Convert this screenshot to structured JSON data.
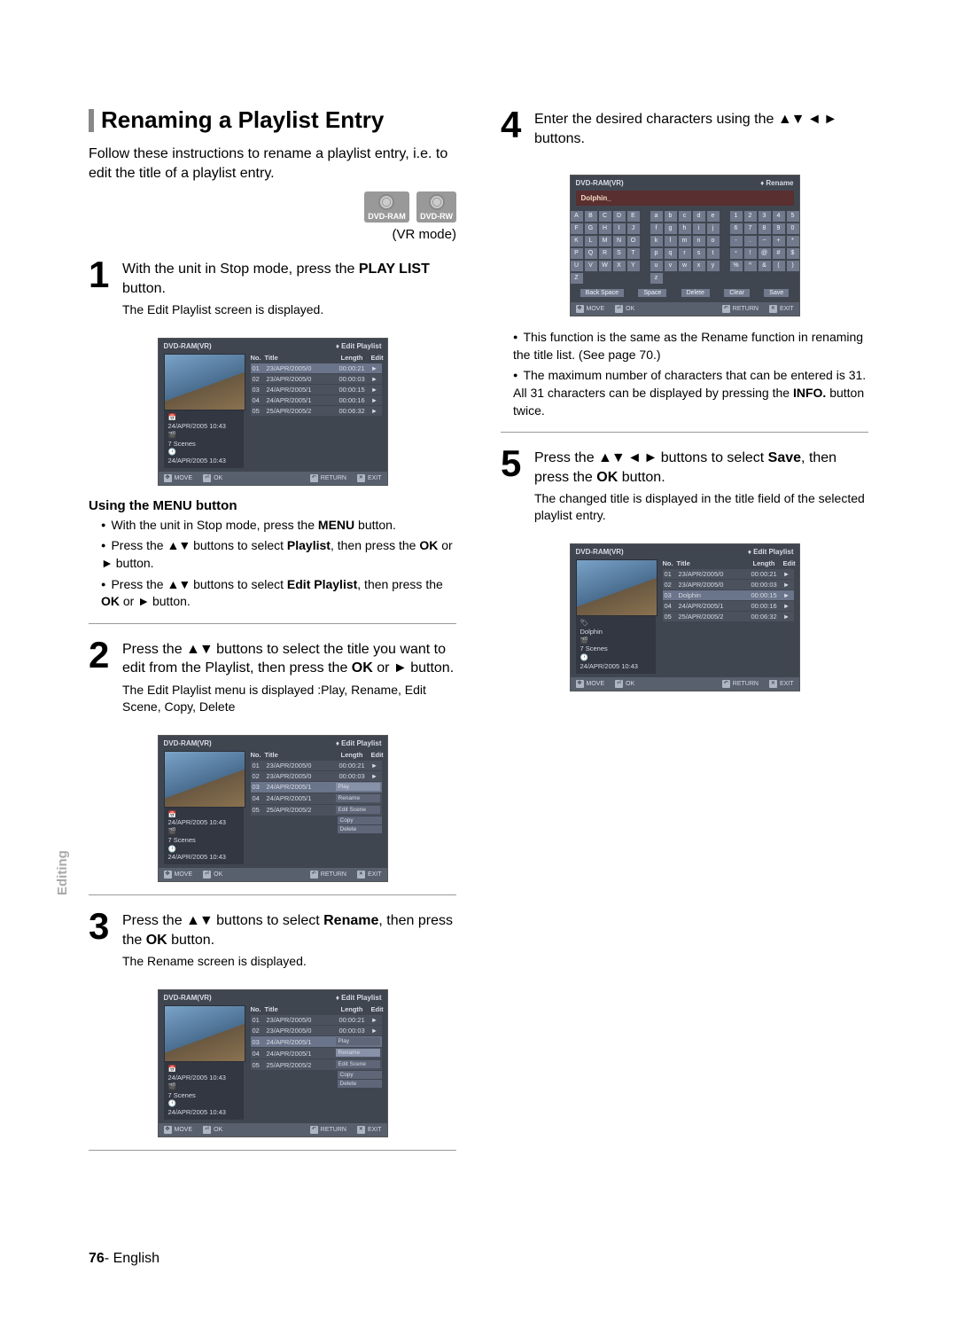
{
  "heading": "Renaming a Playlist Entry",
  "intro": "Follow these instructions to rename a playlist entry, i.e. to edit the title of a playlist entry.",
  "disc_labels": [
    "DVD-RAM",
    "DVD-RW"
  ],
  "vr_mode": "(VR mode)",
  "steps": {
    "s1": {
      "num": "1",
      "text_1": "With the unit in Stop mode, press the ",
      "bold": "PLAY LIST",
      "text_2": " button.",
      "sub": "The Edit Playlist screen is displayed."
    },
    "s2": {
      "num": "2",
      "text_1": "Press the ",
      "arrows1": "▲▼",
      "text_2": " buttons to select the title you want to edit from the Playlist, then press the ",
      "bold1": "OK",
      "or": " or ",
      "arrow2": "►",
      "text_3": " button.",
      "sub": "The Edit Playlist menu is displayed :Play, Rename, Edit Scene, Copy, Delete"
    },
    "s3": {
      "num": "3",
      "text_1": "Press the ",
      "arrows1": "▲▼",
      "text_2": " buttons to select ",
      "bold": "Rename",
      "text_3": ", then press the ",
      "bold2": "OK",
      "text_4": " button.",
      "sub": "The Rename screen is displayed."
    },
    "s4": {
      "num": "4",
      "text_1": "Enter the desired characters using the ",
      "arrows1": "▲▼ ◄ ►",
      "text_2": " buttons."
    },
    "s5": {
      "num": "5",
      "text_1": "Press the ",
      "arrows1": "▲▼ ◄ ►",
      "text_2": " buttons to select ",
      "bold": "Save",
      "text_3": ", then press the ",
      "bold2": "OK",
      "text_4": " button.",
      "sub": "The changed title is displayed in the title field of the selected playlist entry."
    }
  },
  "using_menu": {
    "title": "Using the MENU button",
    "items": [
      "With the unit in Stop mode, press the <b>MENU</b> button.",
      "Press the <span class=\"arrows\">▲▼</span> buttons to select <b>Playlist</b>, then press the <b>OK</b> or <span class=\"arrows\">►</span> button.",
      "Press the <span class=\"arrows\">▲▼</span> buttons to select <b>Edit Playlist</b>, then press the <b>OK</b> or <span class=\"arrows\">►</span> button."
    ]
  },
  "step4_bullets": [
    "This function is the same as the Rename function in renaming the title list. (See page 70.)",
    "The maximum number of characters that can be entered is 31. All 31 characters can be displayed by pressing the <b>INFO.</b> button twice."
  ],
  "screen_common": {
    "header_left": "DVD-RAM(VR)",
    "header_edit": "Edit Playlist",
    "header_rename": "Rename",
    "list_cols": {
      "no": "No.",
      "title": "Title",
      "length": "Length",
      "edit": "Edit"
    },
    "meta": {
      "date": "24/APR/2005 10:43",
      "scenes": "7 Scenes",
      "date2": "24/APR/2005 10:43"
    },
    "meta_dolphin": "Dolphin",
    "bottom": {
      "move": "MOVE",
      "ok": "OK",
      "return": "RETURN",
      "exit": "EXIT"
    }
  },
  "screen_rows": [
    {
      "no": "01",
      "title": "23/APR/2005/0",
      "len": "00:00:21"
    },
    {
      "no": "02",
      "title": "23/APR/2005/0",
      "len": "00:00:03"
    },
    {
      "no": "03",
      "title": "24/APR/2005/1",
      "len": "00:00:15"
    },
    {
      "no": "04",
      "title": "24/APR/2005/1",
      "len": "00:00:16"
    },
    {
      "no": "05",
      "title": "25/APR/2005/2",
      "len": "00:06:32"
    }
  ],
  "screen_rows_alt": [
    {
      "no": "01",
      "title": "23/APR/2005/0",
      "len": "00:00:21"
    },
    {
      "no": "02",
      "title": "23/APR/2005/0",
      "len": "00:00:03"
    },
    {
      "no": "03",
      "title": "Dolphin",
      "len": "00:00:15"
    },
    {
      "no": "04",
      "title": "24/APR/2005/1",
      "len": "00:00:16"
    },
    {
      "no": "05",
      "title": "25/APR/2005/2",
      "len": "00:06:32"
    }
  ],
  "context_menu": [
    "Play",
    "Rename",
    "Edit Scene",
    "Copy",
    "Delete"
  ],
  "rename_field": "Dolphin_",
  "keyboard": {
    "upper": [
      "A",
      "B",
      "C",
      "D",
      "E",
      "F",
      "G",
      "H",
      "I",
      "J",
      "K",
      "L",
      "M",
      "N",
      "O",
      "P",
      "Q",
      "R",
      "S",
      "T",
      "U",
      "V",
      "W",
      "X",
      "Y",
      "Z"
    ],
    "lower": [
      "a",
      "b",
      "c",
      "d",
      "e",
      "f",
      "g",
      "h",
      "i",
      "j",
      "k",
      "l",
      "m",
      "n",
      "o",
      "p",
      "q",
      "r",
      "s",
      "t",
      "u",
      "v",
      "w",
      "x",
      "y",
      "z"
    ],
    "sym": [
      "1",
      "2",
      "3",
      "4",
      "5",
      "6",
      "7",
      "8",
      "9",
      "0",
      "-",
      ".",
      "~",
      "+",
      "*",
      "﹡",
      "!",
      "@",
      "#",
      "$",
      "%",
      "^",
      "&",
      "(",
      ")"
    ]
  },
  "kb_actions": [
    "Back Space",
    "Space",
    "Delete",
    "Clear",
    "Save"
  ],
  "sidetab": "Editing",
  "page_footer_num": "76",
  "page_footer_lang": "- English"
}
